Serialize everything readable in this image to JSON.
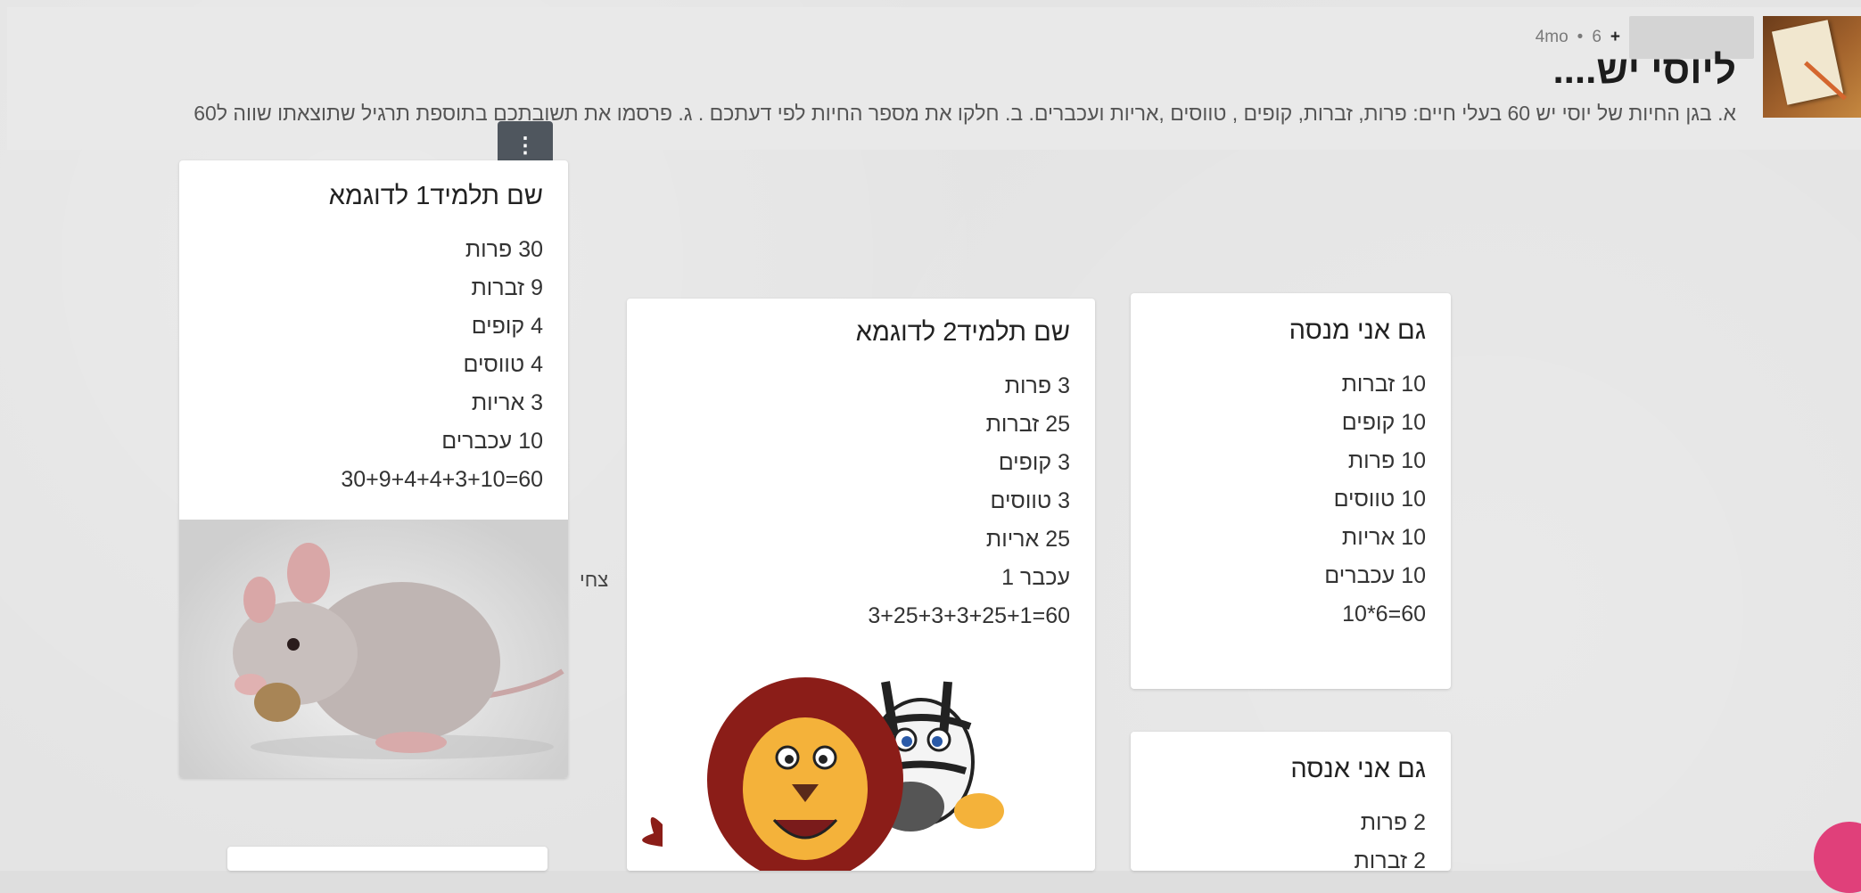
{
  "header": {
    "meta_time": "4mo",
    "meta_dot": "•",
    "meta_count": "6",
    "meta_plus": "+",
    "title": "ליוסי יש....",
    "description": "א. בגן החיות של יוסי יש 60 בעלי חיים: פרות, זברות, קופים , טווסים ,אריות ועכברים. ב. חלקו את מספר החיות לפי דעתכם . ג. פרסמו את תשובתכם בתוספת תרגיל שתוצאתו שווה ל60"
  },
  "icons": {
    "kebab": "more-vertical-icon",
    "fab": "add-post-icon"
  },
  "cards": {
    "student1": {
      "title": "שם תלמיד1 לדוגמא",
      "lines": [
        "30 פרות",
        "9 זברות",
        "4 קופים",
        "4 טווסים",
        "3 אריות",
        "10 עכברים",
        "60=30+9+4+4+3+10"
      ]
    },
    "student2": {
      "title": "שם תלמיד2 לדוגמא",
      "lines": [
        "3 פרות",
        "25 זברות",
        "3 קופים",
        "3 טווסים",
        "25 אריות",
        "עכבר 1",
        "60=3+25+3+3+25+1"
      ]
    },
    "menashe": {
      "title": "גם אני מנסה",
      "lines": [
        "10 זברות",
        "10 קופים",
        "10 פרות",
        "10 טווסים",
        "10 אריות",
        "10 עכברים",
        "60=6*10"
      ]
    },
    "anase": {
      "title": "גם אני אנסה",
      "lines": [
        "2 פרות",
        "2 זברות"
      ]
    }
  },
  "side_label": "צחי",
  "colors": {
    "accent_fab": "#e0407a",
    "kebab_bg": "#4f565e"
  }
}
